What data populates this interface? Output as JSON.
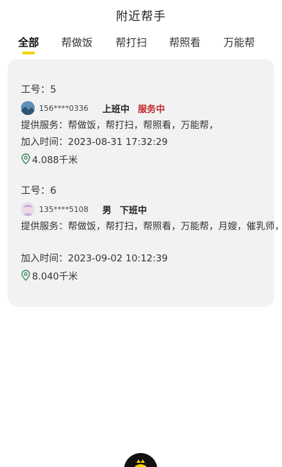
{
  "header": {
    "title": "附近帮手"
  },
  "tabs": [
    {
      "label": "全部",
      "active": true
    },
    {
      "label": "帮做饭",
      "active": false
    },
    {
      "label": "帮打扫",
      "active": false
    },
    {
      "label": "帮照看",
      "active": false
    },
    {
      "label": "万能帮",
      "active": false
    }
  ],
  "workers": [
    {
      "id_label": "工号：5",
      "phone": "156****0336",
      "state": "上班中",
      "busy": "服务中",
      "services": "提供服务：帮做饭，帮打扫，帮照看，万能帮，",
      "joined": "加入时间：2023-08-31 17:32:29",
      "distance": "4.088千米"
    },
    {
      "id_label": "工号：6",
      "phone": "135****5108",
      "gender": "男",
      "state": "下班中",
      "services": "提供服务：帮做饭，帮打扫，帮照看，万能帮，月嫂，催乳师，",
      "joined": "加入时间：2023-09-02 10:12:39",
      "distance": "8.040千米"
    }
  ],
  "colors": {
    "accent": "#f5d200",
    "busy": "#c0282d",
    "card_bg": "#f2f2f2",
    "pin": "#3a8a5a"
  }
}
